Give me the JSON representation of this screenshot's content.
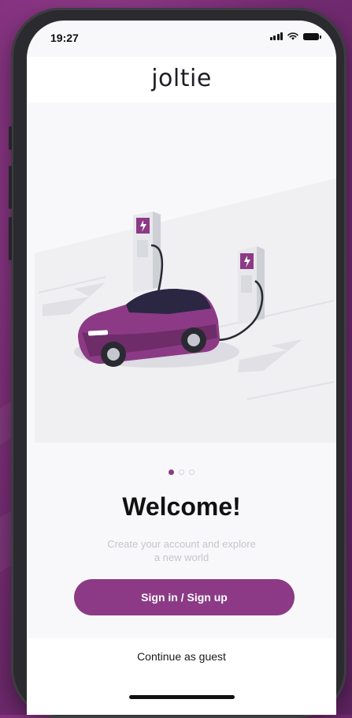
{
  "status_bar": {
    "time": "19:27",
    "icons": [
      "signal-icon",
      "wifi-icon",
      "battery-icon"
    ]
  },
  "header": {
    "logo": "joltie"
  },
  "illustration": {
    "name": "electric-car-charging-illustration",
    "accent": "#8c3a86"
  },
  "pagination": {
    "count": 3,
    "active_index": 0
  },
  "onboarding": {
    "title": "Welcome!",
    "subtitle_line1": "Create your account and explore",
    "subtitle_line2": "a new world"
  },
  "actions": {
    "primary_label": "Sign in / Sign up",
    "secondary_label": "Continue as guest"
  },
  "colors": {
    "accent": "#8c3a86",
    "background": "#7e2f7a"
  }
}
